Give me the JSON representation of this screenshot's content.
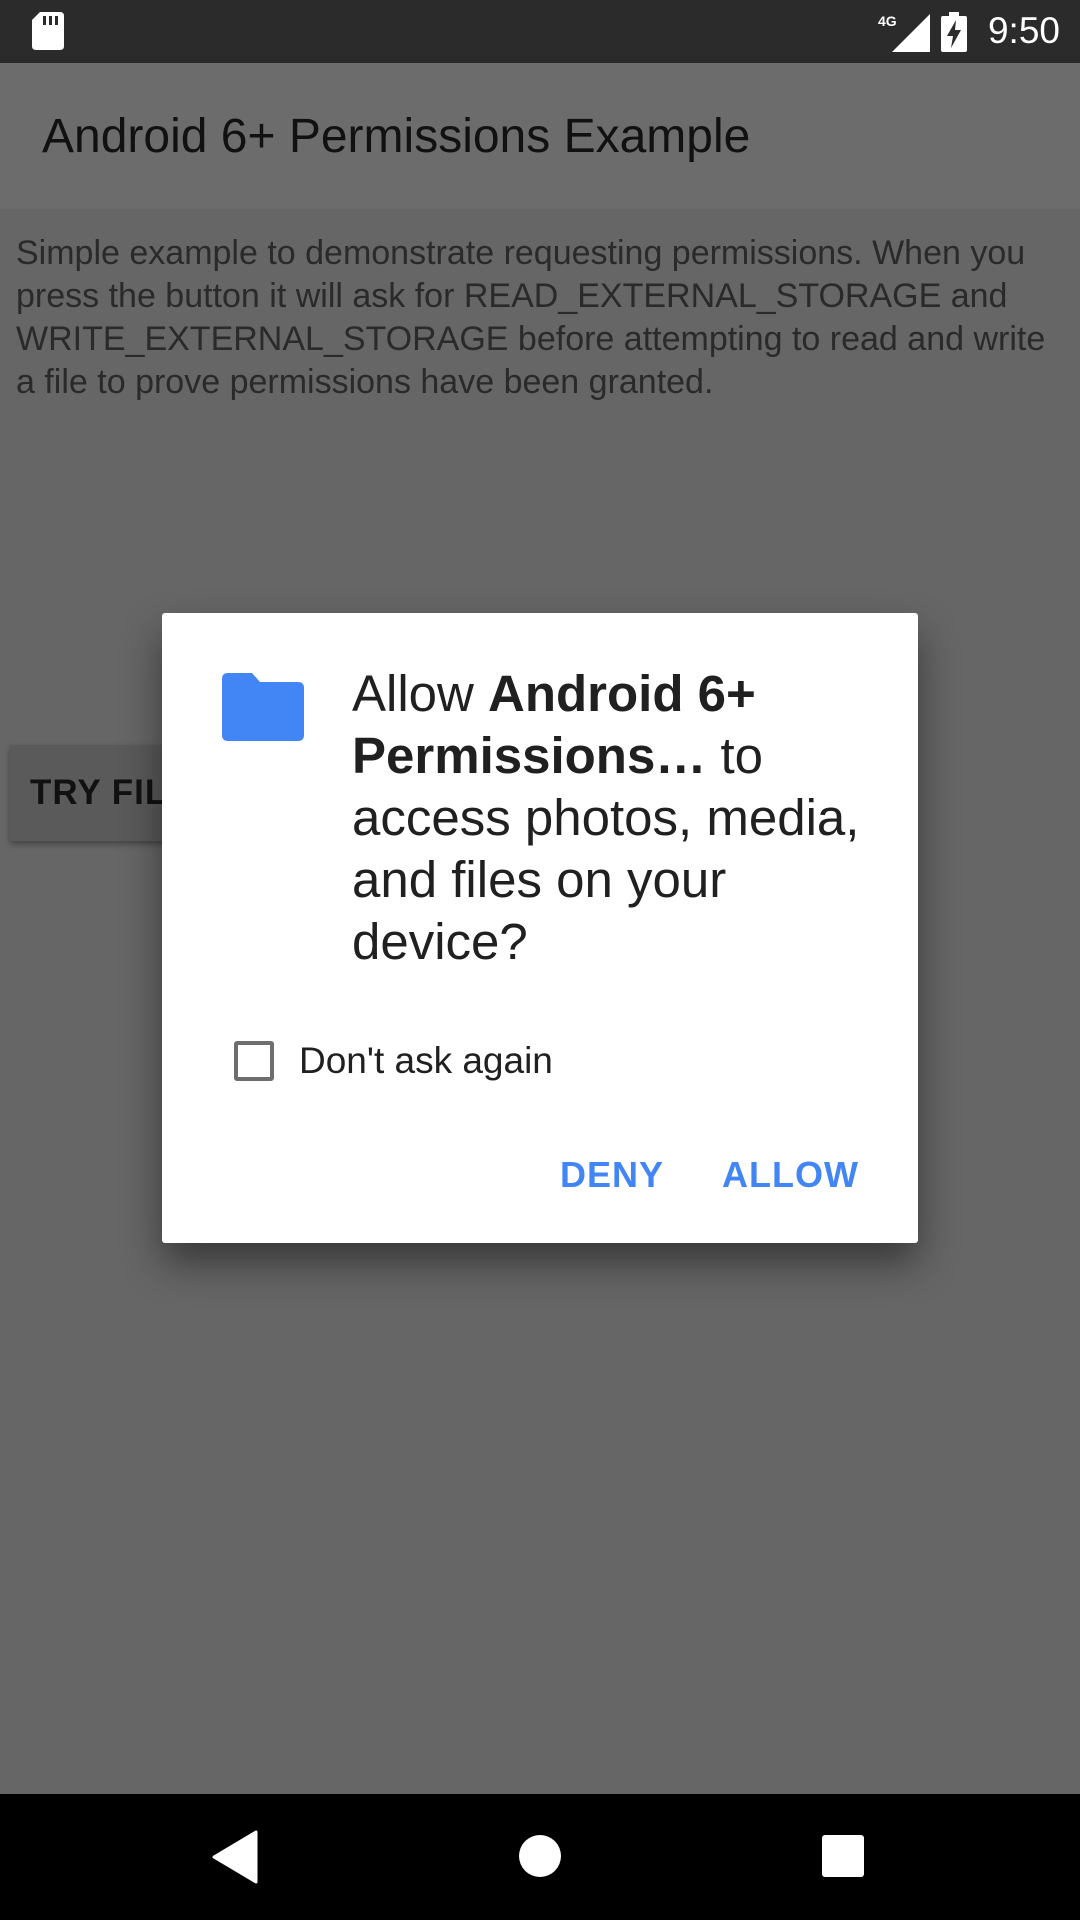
{
  "status_bar": {
    "time": "9:50",
    "network_label": "4G",
    "icons": [
      "sd-card-icon",
      "cell-signal-icon",
      "battery-charging-icon"
    ]
  },
  "app_bar": {
    "title": "Android 6+ Permissions Example"
  },
  "content": {
    "intro": "Simple example to demonstrate requesting permissions. When you press the button it will ask for READ_EXTERNAL_STORAGE and WRITE_EXTERNAL_STORAGE before attempting to read and write a file to prove permissions have been granted.",
    "button_label": "TRY FILE"
  },
  "dialog": {
    "icon": "folder-icon",
    "message_prefix": "Allow ",
    "app_name": "Android 6+ Permissions…",
    "message_suffix": " to access photos, media, and files on your device?",
    "checkbox_label": "Don't ask again",
    "checkbox_checked": false,
    "deny_label": "DENY",
    "allow_label": "ALLOW",
    "accent_color": "#4285f4"
  },
  "nav_bar": {
    "icons": [
      "back-icon",
      "home-icon",
      "recents-icon"
    ]
  }
}
